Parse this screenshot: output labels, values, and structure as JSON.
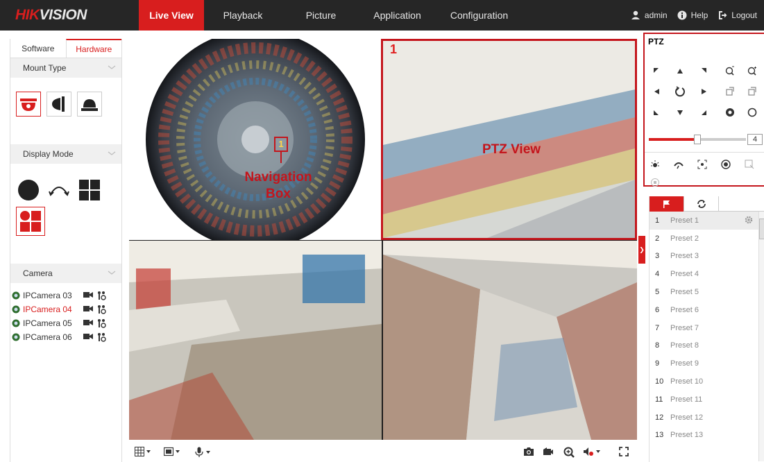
{
  "brand": {
    "logo_prefix": "HIK",
    "logo_suffix": "VISION",
    "accent": "#d81e1e"
  },
  "nav": {
    "tabs": [
      {
        "label": "Live View",
        "active": true
      },
      {
        "label": "Playback"
      },
      {
        "label": "Picture"
      },
      {
        "label": "Application"
      },
      {
        "label": "Configuration"
      }
    ],
    "user": "admin",
    "help": "Help",
    "logout": "Logout"
  },
  "left": {
    "tabs": [
      {
        "label": "Software"
      },
      {
        "label": "Hardware",
        "active": true
      }
    ],
    "mount_type": "Mount Type",
    "display_mode": "Display Mode",
    "camera": "Camera",
    "cameras": [
      {
        "name": "IPCamera 03"
      },
      {
        "name": "IPCamera 04",
        "active": true
      },
      {
        "name": "IPCamera 05"
      },
      {
        "name": "IPCamera 06"
      }
    ]
  },
  "video": {
    "navigation_box_label": "Navigation Box",
    "navigation_box_number": "1",
    "ptz_view_label": "PTZ View",
    "window_number": "1"
  },
  "ptz": {
    "title": "PTZ",
    "speed": "4",
    "speed_level": 0.5
  },
  "presets": {
    "items": [
      {
        "num": "1",
        "label": "Preset 1"
      },
      {
        "num": "2",
        "label": "Preset 2"
      },
      {
        "num": "3",
        "label": "Preset 3"
      },
      {
        "num": "4",
        "label": "Preset 4"
      },
      {
        "num": "5",
        "label": "Preset 5"
      },
      {
        "num": "6",
        "label": "Preset 6"
      },
      {
        "num": "7",
        "label": "Preset 7"
      },
      {
        "num": "8",
        "label": "Preset 8"
      },
      {
        "num": "9",
        "label": "Preset 9"
      },
      {
        "num": "10",
        "label": "Preset 10"
      },
      {
        "num": "11",
        "label": "Preset 11"
      },
      {
        "num": "12",
        "label": "Preset 12"
      },
      {
        "num": "13",
        "label": "Preset 13"
      }
    ]
  }
}
